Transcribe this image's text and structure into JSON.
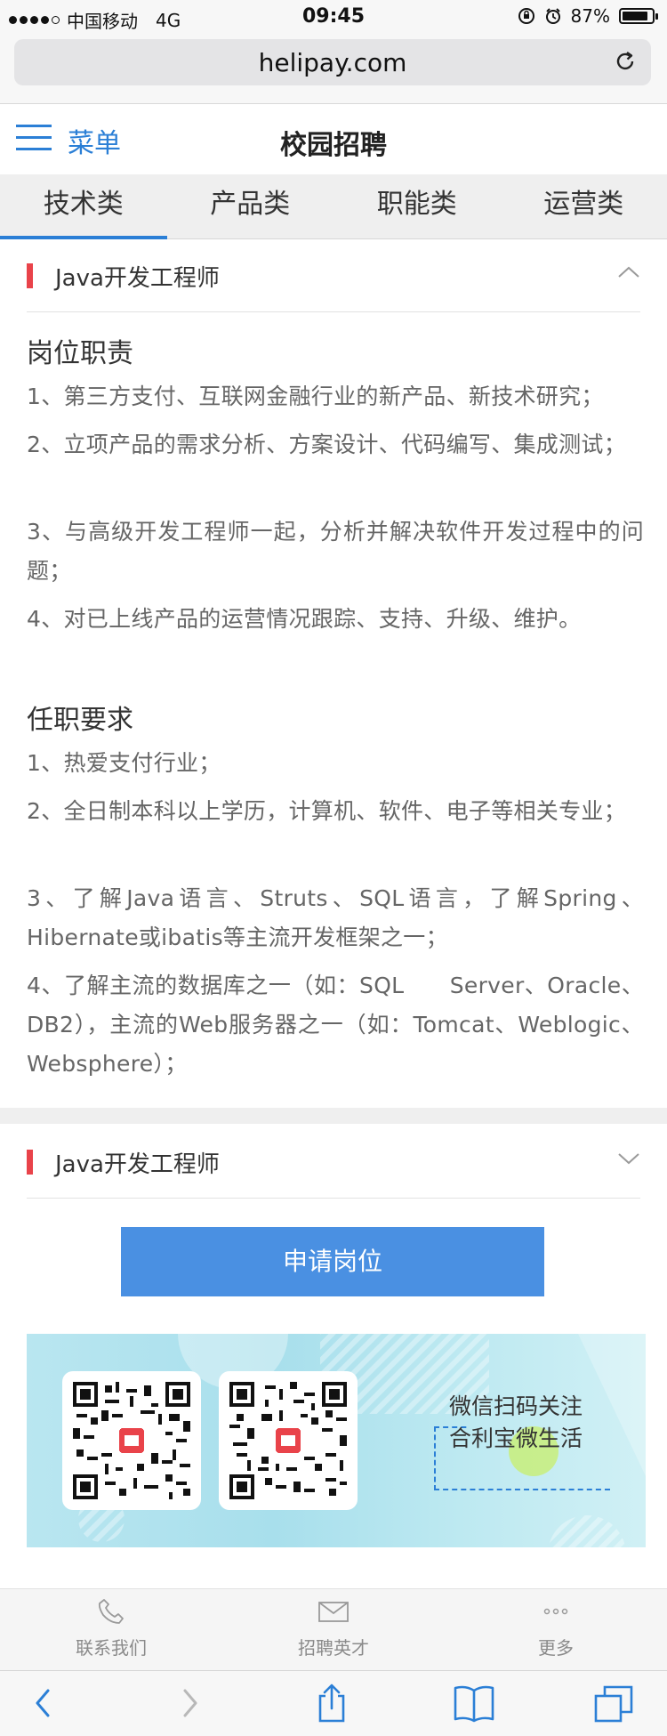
{
  "status": {
    "carrier": "中国移动",
    "network": "4G",
    "time": "09:45",
    "battery": "87%",
    "battery_level": 0.87
  },
  "browser": {
    "url": "helipay.com",
    "reload_icon": "reload-icon"
  },
  "header": {
    "menu_label": "菜单",
    "title": "校园招聘"
  },
  "tabs": [
    {
      "label": "技术类",
      "active": true
    },
    {
      "label": "产品类",
      "active": false
    },
    {
      "label": "职能类",
      "active": false
    },
    {
      "label": "运营类",
      "active": false
    }
  ],
  "jobs": [
    {
      "title": "Java开发工程师",
      "expanded": true,
      "duties_title": "岗位职责",
      "duties": [
        "1、第三方支付、互联网金融行业的新产品、新技术研究；",
        "2、立项产品的需求分析、方案设计、代码编写、集成测试；",
        "3、与高级开发工程师一起，分析并解决软件开发过程中的问题；",
        "4、对已上线产品的运营情况跟踪、支持、升级、维护。"
      ],
      "requirements_title": "任职要求",
      "requirements": [
        "1、热爱支付行业；",
        "2、全日制本科以上学历，计算机、软件、电子等相关专业；",
        "3、了解Java语言、Struts、SQL语言，了解Spring、Hibernate或ibatis等主流开发框架之一；",
        "4、了解主流的数据库之一（如：SQL　　Server、Oracle、DB2），主流的Web服务器之一（如：Tomcat、Weblogic、Websphere）；"
      ]
    },
    {
      "title": "Java开发工程师",
      "expanded": false
    }
  ],
  "apply_button": "申请岗位",
  "banner": {
    "line1": "微信扫码关注",
    "line2": "合利宝微生活"
  },
  "site_nav": [
    {
      "label": "联系我们",
      "icon": "phone-icon"
    },
    {
      "label": "招聘英才",
      "icon": "mail-icon"
    },
    {
      "label": "更多",
      "icon": "more-icon"
    }
  ],
  "toolbar": [
    "back-icon",
    "forward-icon",
    "share-icon",
    "bookmarks-icon",
    "tabs-icon"
  ]
}
